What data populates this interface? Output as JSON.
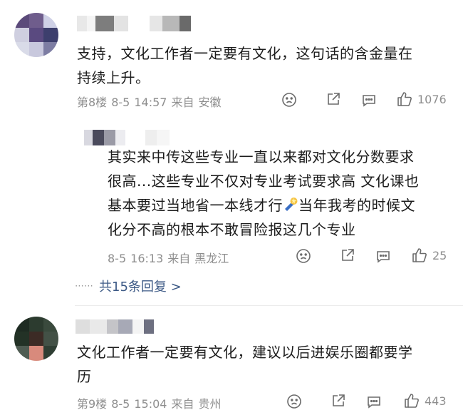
{
  "comments": [
    {
      "text_line1": "支持，文化工作者一定要有文化，这句话的含金量在",
      "text_line2": "持续上升。",
      "floor": "第8楼",
      "date": "8-5",
      "time": "14:57",
      "location_prefix": "来自",
      "location": "安徽",
      "like_count": "1076"
    },
    {
      "text_line1": "文化工作者一定要有文化，建议以后进娱乐圈都要学",
      "text_line2": "历",
      "floor": "第9楼",
      "date": "8-5",
      "time": "15:04",
      "location_prefix": "来自",
      "location": "贵州",
      "like_count": "443"
    }
  ],
  "reply": {
    "line1": "其实来中传这些专业一直以来都对文化分数要求",
    "line2": "很高...这些专业不仅对专业考试要求高 文化课也",
    "line3_a": "基本要过当地省一本线才行",
    "line3_b": "当年我考的时候文",
    "line4": "化分不高的根本不敢冒险报这几个专业",
    "date": "8-5",
    "time": "16:13",
    "location_prefix": "来自",
    "location": "黑龙江",
    "like_count": "25"
  },
  "more_replies": {
    "dots": "⋯⋯",
    "label": "共15条回复 >"
  },
  "icons": [
    "sad-face-icon",
    "share-icon",
    "comment-icon",
    "thumbs-up-icon",
    "megaphone-emoji-icon"
  ],
  "colors": {
    "link": "#3d5a86",
    "meta": "#8e8e8e",
    "text": "#1c1c1c"
  }
}
